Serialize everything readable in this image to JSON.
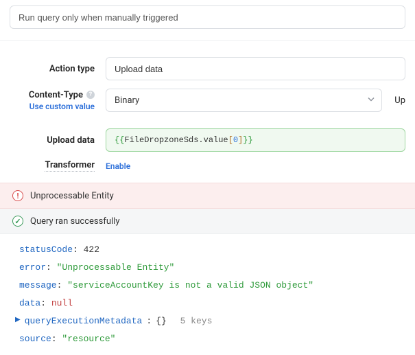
{
  "topField": {
    "value": "Run query only when manually triggered"
  },
  "form": {
    "actionType": {
      "label": "Action type",
      "value": "Upload data"
    },
    "contentType": {
      "label": "Content-Type",
      "hint": "Use custom value",
      "value": "Binary",
      "rightLabel": "Up"
    },
    "uploadData": {
      "label": "Upload data",
      "expr_open": "{{",
      "expr_ident": "FileDropzoneSds.value",
      "expr_idx": "0",
      "expr_close": "}}"
    },
    "transformer": {
      "label": "Transformer",
      "action": "Enable"
    }
  },
  "banners": {
    "error": "Unprocessable Entity",
    "success": "Query ran successfully",
    "errorGlyph": "!",
    "okGlyph": "✓"
  },
  "result": {
    "statusCode": {
      "key": "statusCode",
      "value": "422"
    },
    "error": {
      "key": "error",
      "value": "\"Unprocessable Entity\""
    },
    "message": {
      "key": "message",
      "value": "\"serviceAccountKey is not a valid JSON object\""
    },
    "data": {
      "key": "data",
      "value": "null"
    },
    "queryMeta": {
      "key": "queryExecutionMetadata",
      "braces": "{}",
      "note": "5 keys",
      "arrow": "▶"
    },
    "source": {
      "key": "source",
      "value": "\"resource\""
    }
  }
}
